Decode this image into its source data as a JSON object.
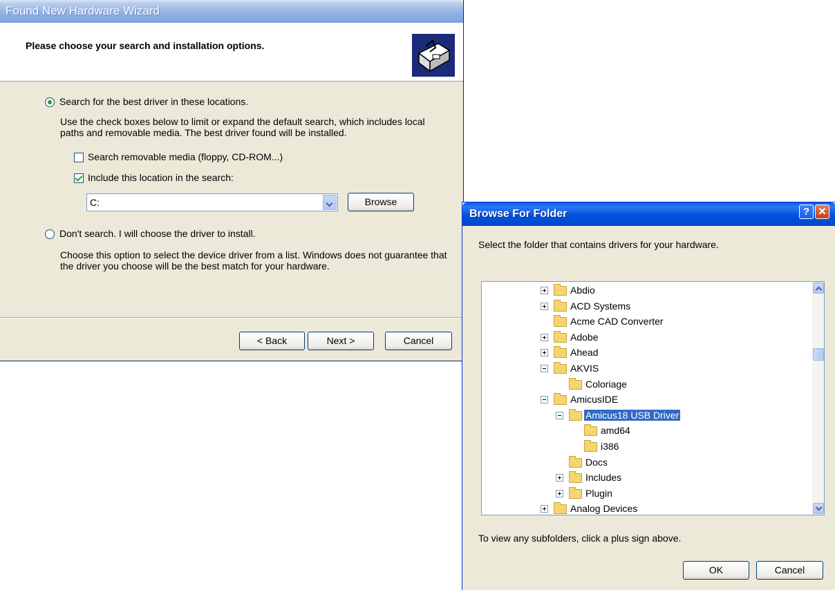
{
  "wizard": {
    "title": "Found New Hardware Wizard",
    "heading": "Please choose your search and installation options.",
    "option_search": {
      "label": "Search for the best driver in these locations.",
      "selected": true,
      "description": "Use the check boxes below to limit or expand the default search, which includes local paths and removable media. The best driver found will be installed."
    },
    "checkbox_removable": {
      "label": "Search removable media (floppy, CD-ROM...)",
      "checked": false
    },
    "checkbox_location": {
      "label": "Include this location in the search:",
      "checked": true
    },
    "location_value": "C:",
    "browse_label": "Browse",
    "option_dont_search": {
      "label": "Don't search. I will choose the driver to install.",
      "selected": false,
      "description": "Choose this option to select the device driver from a list.  Windows does not guarantee that the driver you choose will be the best match for your hardware."
    },
    "buttons": {
      "back": "< Back",
      "next": "Next >",
      "cancel": "Cancel"
    }
  },
  "browse": {
    "title": "Browse For Folder",
    "help_glyph": "?",
    "close_glyph": "✕",
    "prompt": "Select the folder that contains drivers for your hardware.",
    "tree": [
      {
        "name": "Abdio",
        "level": 0,
        "expander": "plus"
      },
      {
        "name": "ACD Systems",
        "level": 0,
        "expander": "plus"
      },
      {
        "name": "Acme CAD Converter",
        "level": 0,
        "expander": "none"
      },
      {
        "name": "Adobe",
        "level": 0,
        "expander": "plus"
      },
      {
        "name": "Ahead",
        "level": 0,
        "expander": "plus"
      },
      {
        "name": "AKVIS",
        "level": 0,
        "expander": "minus"
      },
      {
        "name": "Coloriage",
        "level": 1,
        "expander": "none"
      },
      {
        "name": "AmicusIDE",
        "level": 0,
        "expander": "minus"
      },
      {
        "name": "Amicus18 USB Driver",
        "level": 1,
        "expander": "minus",
        "selected": true
      },
      {
        "name": "amd64",
        "level": 2,
        "expander": "none"
      },
      {
        "name": "i386",
        "level": 2,
        "expander": "none"
      },
      {
        "name": "Docs",
        "level": 1,
        "expander": "none"
      },
      {
        "name": "Includes",
        "level": 1,
        "expander": "plus"
      },
      {
        "name": "Plugin",
        "level": 1,
        "expander": "plus"
      },
      {
        "name": "Analog Devices",
        "level": 0,
        "expander": "plus"
      }
    ],
    "hint": "To view any subfolders, click a plus sign above.",
    "ok_label": "OK",
    "cancel_label": "Cancel"
  }
}
